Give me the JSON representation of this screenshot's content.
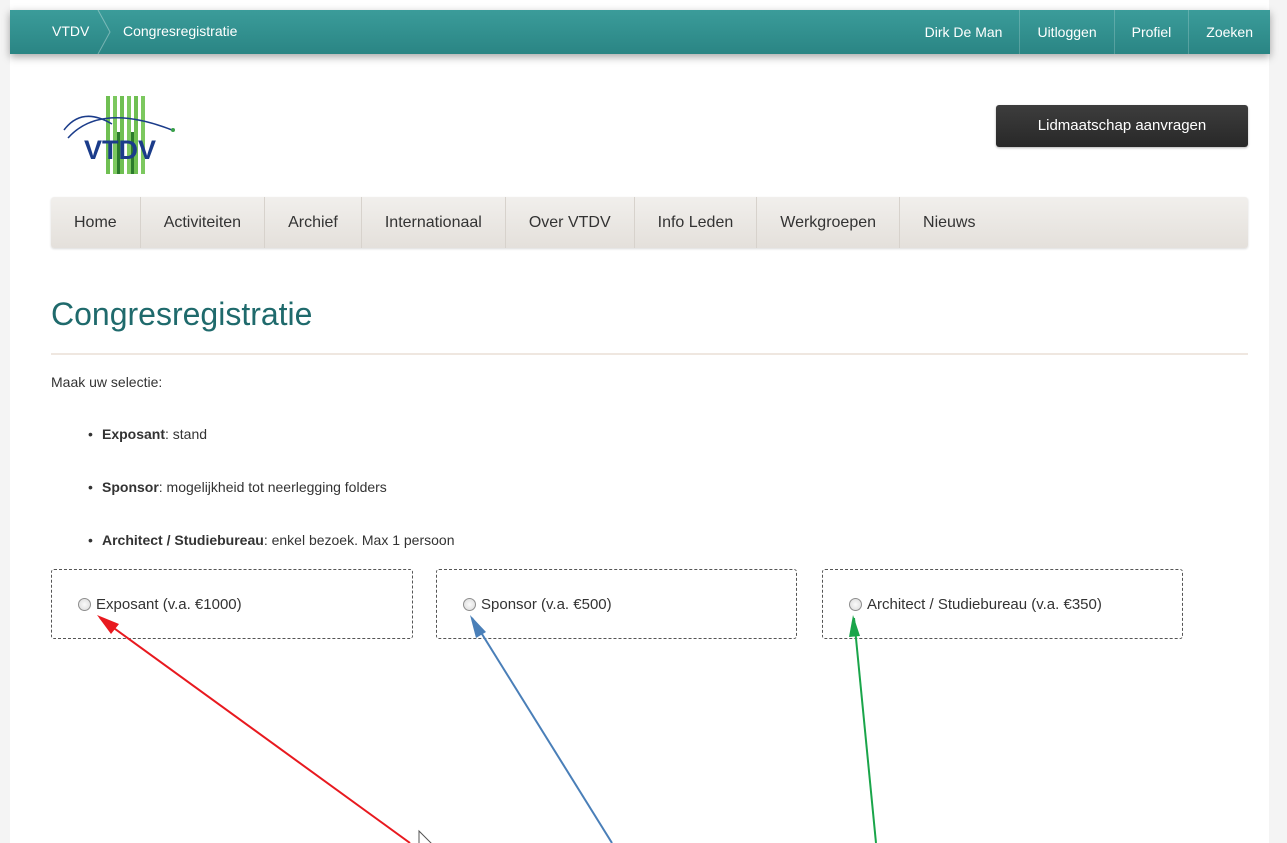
{
  "breadcrumb": {
    "home": "VTDV",
    "current": "Congresregistratie"
  },
  "topnav": [
    {
      "label": "Dirk De Man"
    },
    {
      "label": "Uitloggen"
    },
    {
      "label": "Profiel"
    },
    {
      "label": "Zoeken"
    }
  ],
  "logo": {
    "text": "VTDV"
  },
  "cta": {
    "label": "Lidmaatschap aanvragen"
  },
  "mainnav": [
    {
      "label": "Home"
    },
    {
      "label": "Activiteiten"
    },
    {
      "label": "Archief"
    },
    {
      "label": "Internationaal"
    },
    {
      "label": "Over VTDV"
    },
    {
      "label": "Info Leden"
    },
    {
      "label": "Werkgroepen"
    },
    {
      "label": "Nieuws"
    }
  ],
  "page": {
    "title": "Congresregistratie",
    "intro": "Maak uw selectie:",
    "bullets": [
      {
        "term": "Exposant",
        "desc": ": stand"
      },
      {
        "term": "Sponsor",
        "desc": ": mogelijkheid tot neerlegging folders"
      },
      {
        "term": "Architect / Studiebureau",
        "desc": ": enkel bezoek. Max 1 persoon"
      }
    ]
  },
  "options": [
    {
      "label": "Exposant (v.a. €1000)",
      "selected": false
    },
    {
      "label": "Sponsor (v.a. €500)",
      "selected": false
    },
    {
      "label": "Architect / Studiebureau (v.a. €350)",
      "selected": false
    }
  ],
  "colors": {
    "topbar": "#2f8e8d",
    "title": "#1f6a6c",
    "cta": "#2f2f2f",
    "arrow_red": "#e8191f",
    "arrow_blue": "#4a7fb8",
    "arrow_green": "#1aa54a"
  }
}
